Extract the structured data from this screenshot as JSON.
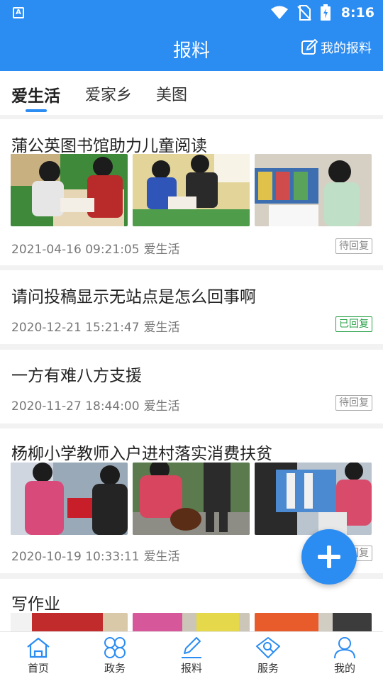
{
  "status_bar": {
    "app_icon_letter": "A",
    "time": "8:16",
    "icons": [
      "wifi-icon",
      "no-sim-icon",
      "battery-charging-icon"
    ]
  },
  "header": {
    "title": "报料",
    "my_report_label": "我的报料",
    "my_report_icon": "edit-icon"
  },
  "tabs": [
    {
      "label": "爱生活",
      "active": true
    },
    {
      "label": "爱家乡",
      "active": false
    },
    {
      "label": "美图",
      "active": false
    }
  ],
  "posts": [
    {
      "title": "蒲公英图书馆助力儿童阅读",
      "date": "2021-04-16 09:21:05",
      "category": "爱生活",
      "status": "待回复",
      "has_images": true
    },
    {
      "title": "请问投稿显示无站点是怎么回事啊",
      "date": "2020-12-21 15:21:47",
      "category": "爱生活",
      "status": "已回复",
      "has_images": false
    },
    {
      "title": "一方有难八方支援",
      "date": "2020-11-27 18:44:00",
      "category": "爱生活",
      "status": "待回复",
      "has_images": false
    },
    {
      "title": "杨柳小学教师入户进村落实消费扶贫",
      "date": "2020-10-19 10:33:11",
      "category": "爱生活",
      "status": "待回复",
      "has_images": true
    },
    {
      "title": "写作业",
      "has_images": true
    }
  ],
  "fab": {
    "icon": "plus-icon"
  },
  "bottom_nav": [
    {
      "label": "首页",
      "icon": "home-icon",
      "active": false
    },
    {
      "label": "政务",
      "icon": "clover-icon",
      "active": false
    },
    {
      "label": "报料",
      "icon": "pencil-icon",
      "active": true
    },
    {
      "label": "服务",
      "icon": "service-icon",
      "active": false
    },
    {
      "label": "我的",
      "icon": "user-icon",
      "active": false
    }
  ],
  "colors": {
    "primary": "#2b8cf2",
    "replied": "#2aa24a",
    "pending": "#888888"
  }
}
